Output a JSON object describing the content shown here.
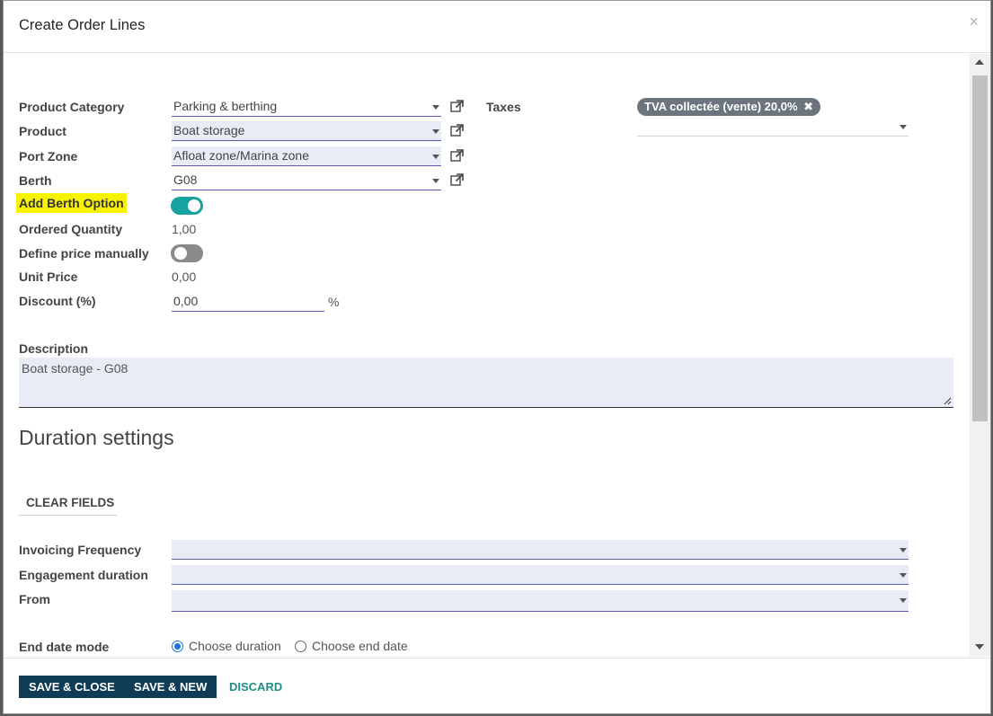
{
  "dialog": {
    "title": "Create Order Lines",
    "close_glyph": "×"
  },
  "fields": {
    "product_category": {
      "label": "Product Category",
      "value": "Parking & berthing"
    },
    "product": {
      "label": "Product",
      "value": "Boat storage"
    },
    "port_zone": {
      "label": "Port Zone",
      "value": "Afloat zone/Marina zone"
    },
    "berth": {
      "label": "Berth",
      "value": "G08"
    },
    "add_berth_option": {
      "label": "Add Berth Option",
      "state": "on"
    },
    "ordered_quantity": {
      "label": "Ordered Quantity",
      "value": "1,00"
    },
    "define_price_manually": {
      "label": "Define price manually",
      "state": "off"
    },
    "unit_price": {
      "label": "Unit Price",
      "value": "0,00"
    },
    "discount": {
      "label": "Discount (%)",
      "value": "0,00",
      "unit": "%"
    },
    "taxes": {
      "label": "Taxes",
      "tag": "TVA collectée (vente) 20,0%",
      "tag_remove_glyph": "✖"
    },
    "description": {
      "label": "Description",
      "value": "Boat storage - G08"
    }
  },
  "duration": {
    "section_title": "Duration settings",
    "clear_button": "CLEAR FIELDS",
    "invoicing_frequency": {
      "label": "Invoicing Frequency",
      "value": ""
    },
    "engagement_duration": {
      "label": "Engagement duration",
      "value": ""
    },
    "from": {
      "label": "From",
      "value": ""
    },
    "end_date_mode": {
      "label": "End date mode",
      "options": [
        "Choose duration",
        "Choose end date"
      ],
      "selected": "Choose duration"
    }
  },
  "footer": {
    "save_close": "SAVE & CLOSE",
    "save_new": "SAVE & NEW",
    "discard": "DISCARD"
  },
  "colors": {
    "highlight": "#f7f200",
    "toggle_on": "#17a2a0",
    "primary_button": "#0f3b57",
    "link": "#1f8f86"
  }
}
